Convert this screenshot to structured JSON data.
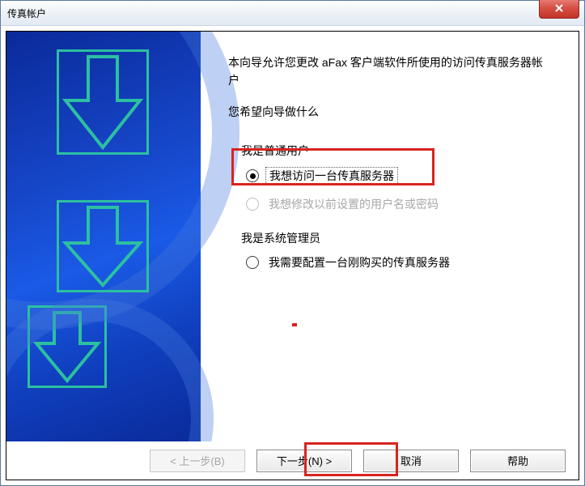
{
  "window": {
    "title": "传真帐户"
  },
  "intro": "本向导允许您更改 aFax 客户端软件所使用的访问传真服务器帐户",
  "prompt": "您希望向导做什么",
  "groups": {
    "regular": {
      "label": "我是普通用户",
      "options": {
        "access": {
          "label": "我想访问一台传真服务器",
          "selected": true,
          "enabled": true
        },
        "modify": {
          "label": "我想修改以前设置的用户名或密码",
          "selected": false,
          "enabled": false
        }
      }
    },
    "admin": {
      "label": "我是系统管理员",
      "options": {
        "configure": {
          "label": "我需要配置一台刚购买的传真服务器",
          "selected": false,
          "enabled": true
        }
      }
    }
  },
  "buttons": {
    "back": "< 上一步(B)",
    "next": "下一步(N) >",
    "cancel": "取消",
    "help": "帮助"
  },
  "icons": {
    "close": "close-icon",
    "down_arrow": "down-arrow-art"
  },
  "colors": {
    "highlight": "#d8241e",
    "art_stroke": "#2cc0a0",
    "art_fill": "#1b56dc"
  }
}
